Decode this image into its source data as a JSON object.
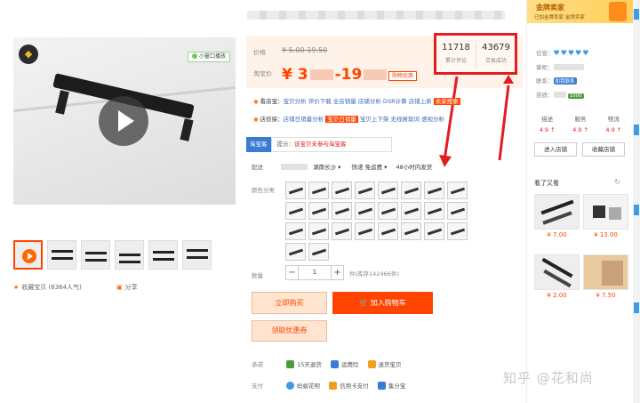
{
  "gallery": {
    "mini_window_label": "小窗口播放",
    "favorite_label": "收藏宝贝",
    "favorite_count": "(6364人气)",
    "share_label": "分享"
  },
  "price": {
    "price_label": "价格",
    "original_price": "¥ 5.00-19.50",
    "promo_label": "淘宝价",
    "promo_price_start": "¥ 3",
    "promo_price_end": "-19",
    "promo_tag": "购物优惠"
  },
  "stats": {
    "reviews_count": "11718",
    "reviews_label": "累计评论",
    "sales_count": "43679",
    "sales_label": "交易成功"
  },
  "tools": {
    "row1_label": "看店宝：",
    "row1_items": "宝贝分析  评价下载  全店销量  店铺分析  DSR计算  店铺上新",
    "row1_highlight": "卖家搜索",
    "row2_label": "店侦探：",
    "row2_items": "店铺日销量分析  ",
    "row2_highlight": "宝贝日销量",
    "row2_tail": "  宝贝上下架  无线展现词  透视分析"
  },
  "notice": {
    "tag": "淘宝客",
    "prefix": "提示：",
    "text": "该宝贝未参与淘宝客"
  },
  "shipping": {
    "label": "配送",
    "destination": "湖南长沙 ▾",
    "fee": "快递 免运费 ▾",
    "dispatch": "48小时内发货"
  },
  "color": {
    "label": "颜色分类"
  },
  "quantity": {
    "label": "数量",
    "minus": "−",
    "value": "1",
    "plus": "+",
    "stock": "件(库存142466件)"
  },
  "actions": {
    "buy_now": "立即购买",
    "add_to_cart": "加入购物车",
    "coupon": "领取优惠券"
  },
  "services": {
    "promise_label": "承诺",
    "promise_items": [
      "15天退货",
      "运费险",
      "退货宝贝"
    ],
    "pay_label": "支付",
    "pay_items": [
      "蚂蚁花呗",
      "信用卡支付",
      "集分宝"
    ]
  },
  "seller": {
    "banner_title": "金牌卖家",
    "banner_sub": "已加金牌卖家 金牌卖家",
    "credit_label": "信誉：",
    "credit_hearts": "♥♥♥♥♥",
    "shopkeeper_label": "掌柜：",
    "contact_label": "联系：",
    "contact_chip": "和我联系",
    "qualification_label": "资质：",
    "qualification_chip": "1000",
    "dsr_headers": [
      "描述",
      "服务",
      "物流"
    ],
    "dsr_scores": [
      "4.9 ↑",
      "4.9 ↑",
      "4.9 ↑"
    ],
    "enter_shop": "进入店铺",
    "collect_shop": "收藏店铺"
  },
  "seen": {
    "title": "看了又看",
    "items": [
      {
        "price": "¥ 7.00"
      },
      {
        "price": "¥ 13.00"
      },
      {
        "price": "¥ 2.00"
      },
      {
        "price": "¥ 7.50"
      }
    ]
  },
  "watermark": "知乎 @花和尚",
  "colors": {
    "accent": "#ff4400",
    "highlight_box": "#e31b23",
    "link": "#3a6bb5"
  }
}
